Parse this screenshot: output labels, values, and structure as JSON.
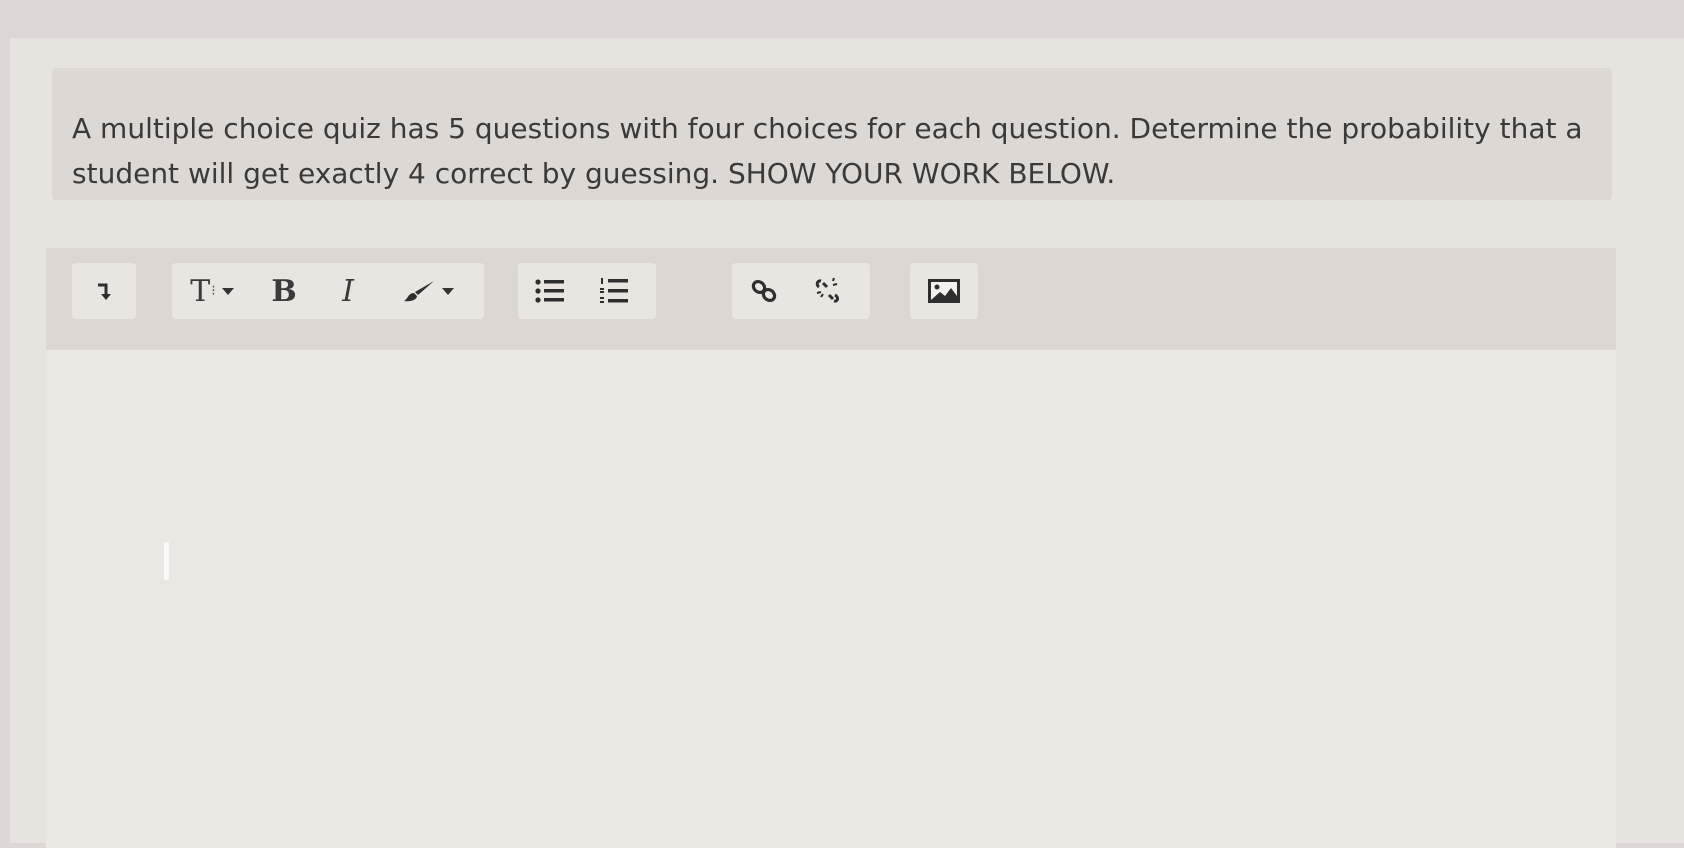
{
  "question": {
    "text": "A multiple choice quiz has 5 questions with four choices for each question. Determine the probability that a student will get exactly 4 correct by guessing. SHOW YOUR WORK BELOW."
  },
  "toolbar": {
    "buttons": [
      {
        "icon": "arrow-return-icon"
      },
      {
        "icon": "text-size-icon",
        "label": "T"
      },
      {
        "icon": "bold-icon",
        "label": "B"
      },
      {
        "icon": "italic-icon",
        "label": "I"
      },
      {
        "icon": "paintbrush-icon"
      },
      {
        "icon": "bulleted-list-icon"
      },
      {
        "icon": "numbered-list-icon"
      },
      {
        "icon": "link-icon"
      },
      {
        "icon": "unlink-icon"
      },
      {
        "icon": "image-icon"
      }
    ]
  },
  "editor": {
    "value": ""
  }
}
